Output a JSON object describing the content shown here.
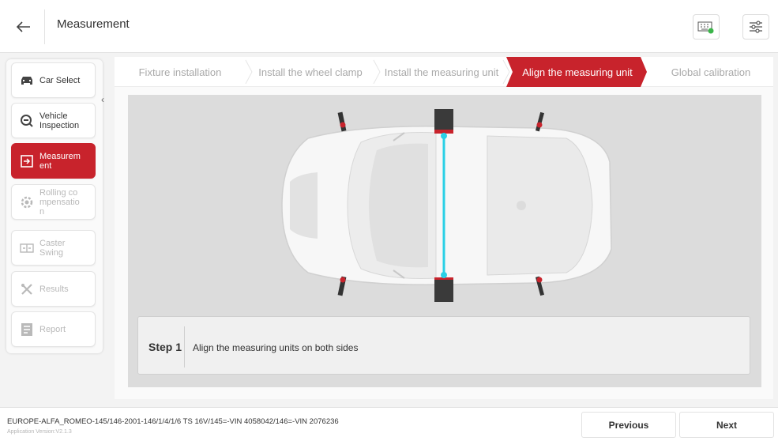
{
  "header": {
    "title": "Measurement",
    "back_icon": "arrow-left-icon",
    "keyboard_icon": "keyboard-icon",
    "settings_icon": "sliders-icon"
  },
  "sidebar": {
    "collapse_icon": "chevron-left-icon",
    "items": [
      {
        "label": "Car Select",
        "icon": "car-icon",
        "state": "normal"
      },
      {
        "label": "Vehicle Inspection",
        "icon": "inspection-icon",
        "state": "normal"
      },
      {
        "label": "Measurement",
        "icon": "measure-icon",
        "state": "active"
      },
      {
        "label": "Rolling compensation",
        "icon": "gear-icon",
        "state": "disabled"
      },
      {
        "label": "Caster Swing",
        "icon": "swing-icon",
        "state": "disabled"
      },
      {
        "label": "Results",
        "icon": "tools-icon",
        "state": "disabled"
      },
      {
        "label": "Report",
        "icon": "report-icon",
        "state": "disabled"
      }
    ]
  },
  "steps": {
    "tabs": [
      {
        "label": "Fixture installation",
        "active": false
      },
      {
        "label": "Install the wheel clamp",
        "active": false
      },
      {
        "label": "Install the measuring unit",
        "active": false
      },
      {
        "label": "Align the measuring unit",
        "active": true
      },
      {
        "label": "Global calibration",
        "active": false
      }
    ]
  },
  "instruction": {
    "step_label": "Step 1",
    "text": "Align the measuring units on both sides"
  },
  "footer": {
    "vehicle": "EUROPE-ALFA_ROMEO-145/146-2001-146/1/4/1/6 TS 16V/145=-VIN 4058042/146=-VIN 2076236",
    "version": "Application Version:V2.1.3",
    "previous_label": "Previous",
    "next_label": "Next"
  },
  "colors": {
    "accent": "#c8232c",
    "alignment_line": "#2ad0e6"
  }
}
